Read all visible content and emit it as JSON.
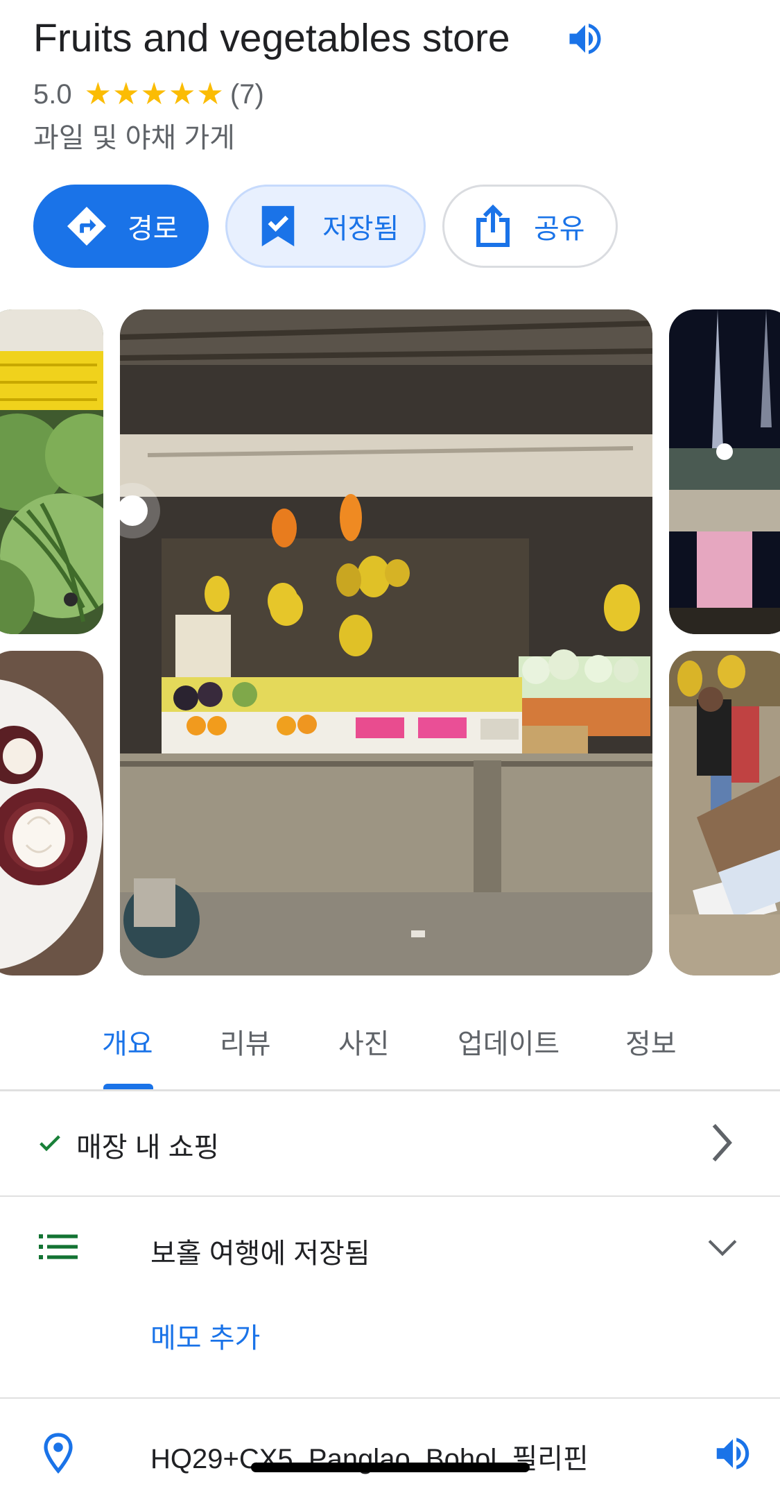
{
  "place": {
    "title": "Fruits and vegetables store",
    "rating": "5.0",
    "stars": [
      "★",
      "★",
      "★",
      "★",
      "★"
    ],
    "review_count": "(7)",
    "category": "과일 및 야채 가게"
  },
  "actions": {
    "directions_label": "경로",
    "saved_label": "저장됨",
    "share_label": "공유"
  },
  "tabs": [
    {
      "label": "개요",
      "active": true
    },
    {
      "label": "리뷰",
      "active": false
    },
    {
      "label": "사진",
      "active": false
    },
    {
      "label": "업데이트",
      "active": false
    },
    {
      "label": "정보",
      "active": false
    }
  ],
  "overview": {
    "shopping_label": "매장 내 쇼핑",
    "saved_list_label": "보홀 여행에 저장됨",
    "add_note_label": "메모 추가",
    "address": "HQ29+CX5, Panglao, Bohol, 필리핀"
  },
  "colors": {
    "accent": "#1a73e8",
    "star": "#fbbc04",
    "check": "#188038",
    "list_icon": "#137333"
  },
  "icons": {
    "speaker": "speaker-icon",
    "directions": "directions-icon",
    "bookmark": "bookmark-check-icon",
    "share": "share-icon",
    "check": "check-icon",
    "chevron_right": "chevron-right-icon",
    "list": "list-icon",
    "chevron_down": "chevron-down-icon",
    "pin": "location-pin-icon"
  }
}
